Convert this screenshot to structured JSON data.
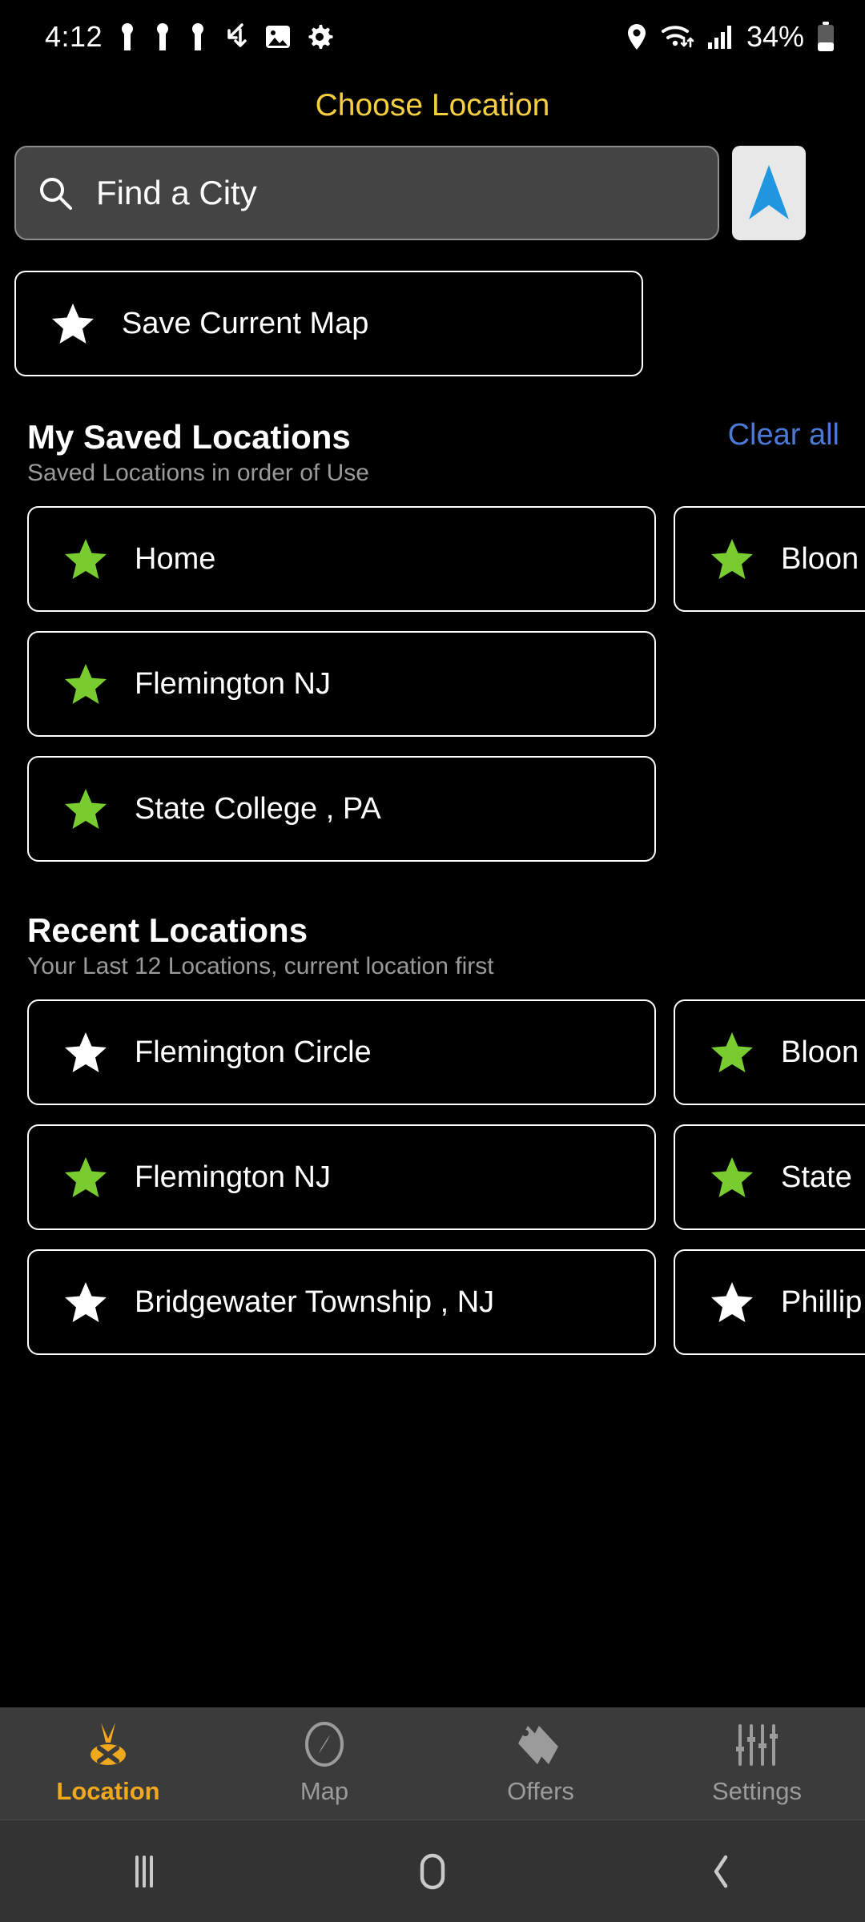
{
  "status_bar": {
    "time": "4:12",
    "battery_percent": "34%",
    "left_icons": [
      "person-notification-icon",
      "person-notification-icon",
      "person-notification-icon",
      "sync-check-icon",
      "image-icon",
      "gear-icon"
    ],
    "right_icons": [
      "location-pin-icon",
      "wifi-icon",
      "cellular-signal-icon",
      "battery-icon"
    ]
  },
  "header": {
    "title": "Choose Location",
    "title_color": "#f5cf3f"
  },
  "search": {
    "placeholder": "Find a City",
    "value": "",
    "icon": "search-icon",
    "gps_button_icon": "navigation-arrow-icon",
    "gps_button_color": "#2196e0"
  },
  "save_current_map": {
    "label": "Save Current Map",
    "icon": "star-icon"
  },
  "saved_section": {
    "title": "My Saved Locations",
    "subtitle": "Saved Locations in order of Use",
    "clear_all_label": "Clear all",
    "clear_all_color": "#4d79d6",
    "items": [
      {
        "label": "Home",
        "star": "green"
      },
      {
        "label": "Bloon",
        "star": "green"
      },
      {
        "label": "Flemington NJ",
        "star": "green"
      },
      {
        "label": "State College , PA",
        "star": "green"
      }
    ]
  },
  "recent_section": {
    "title": "Recent Locations",
    "subtitle": "Your Last 12 Locations, current location first",
    "items": [
      {
        "label": "Flemington Circle",
        "star": "white"
      },
      {
        "label": "Bloon",
        "star": "green"
      },
      {
        "label": "Flemington NJ",
        "star": "green"
      },
      {
        "label": "State",
        "star": "green"
      },
      {
        "label": "Bridgewater Township , NJ",
        "star": "white"
      },
      {
        "label": "Phillip",
        "star": "white"
      }
    ]
  },
  "tab_bar": {
    "active": "Location",
    "active_color": "#f0a81c",
    "inactive_color": "#9b9b9b",
    "tabs": [
      {
        "label": "Location",
        "icon": "location-x-pin-icon"
      },
      {
        "label": "Map",
        "icon": "compass-icon"
      },
      {
        "label": "Offers",
        "icon": "tags-icon"
      },
      {
        "label": "Settings",
        "icon": "sliders-icon"
      }
    ]
  },
  "android_nav": {
    "keys": [
      {
        "name": "recents-key",
        "icon": "recents-icon"
      },
      {
        "name": "home-key",
        "icon": "home-icon"
      },
      {
        "name": "back-key",
        "icon": "back-chevron-icon"
      }
    ]
  },
  "colors": {
    "star_green": "#78cc2f",
    "star_white": "#ffffff",
    "card_border": "#ffffff",
    "background": "#000000"
  }
}
